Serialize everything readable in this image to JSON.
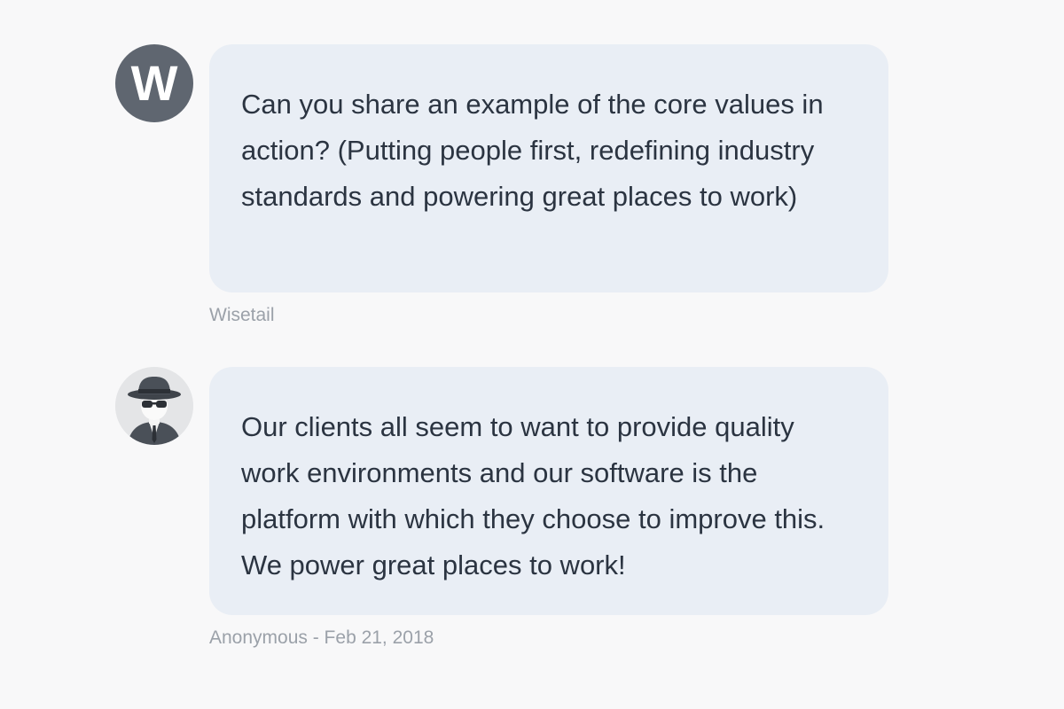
{
  "messages": [
    {
      "avatar_letter": "W",
      "text": "Can you share an example of the core values in action? (Putting people first, redefining industry standards and powering great places to work)",
      "meta": "Wisetail"
    },
    {
      "avatar_icon": "anonymous-spy-icon",
      "text": "Our clients all seem to want to provide quality work environments and our software is the platform with which they choose to improve this. We power great places to work!",
      "meta": "Anonymous - Feb 21, 2018"
    }
  ],
  "colors": {
    "background": "#f8f8f9",
    "bubble": "#e9eef5",
    "text": "#2b3441",
    "meta": "#9ba1a9",
    "avatar_w": "#5f6670"
  }
}
